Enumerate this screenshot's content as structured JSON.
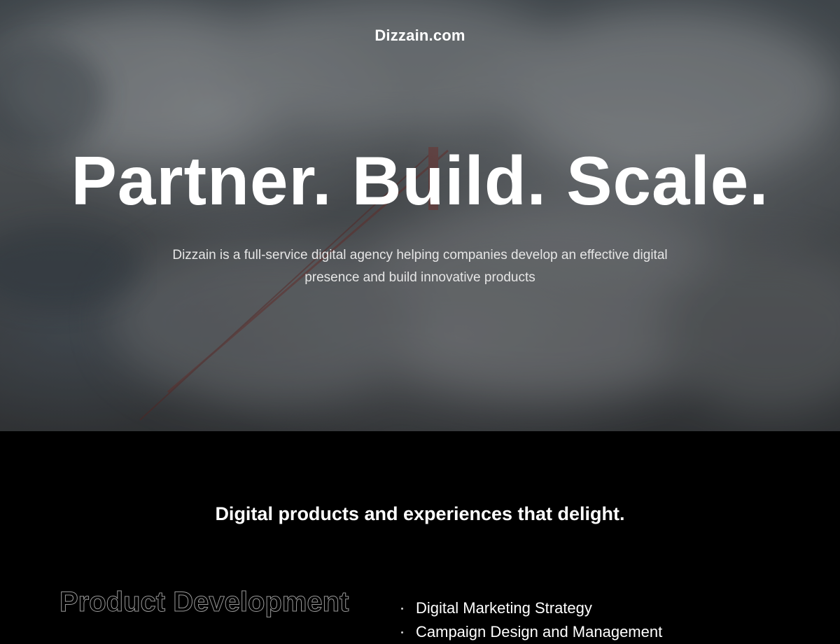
{
  "header": {
    "logo": "Dizzain.com"
  },
  "hero": {
    "headline": "Partner. Build. Scale.",
    "subhead": "Dizzain is a full-service digital agency helping companies develop an effective digital presence and build innovative products"
  },
  "intro": {
    "tagline": "Digital products and experiences that delight."
  },
  "services": {
    "category": "Product Development",
    "items": [
      {
        "label": "Digital Marketing Strategy"
      },
      {
        "label": "Campaign Design and Management"
      }
    ]
  },
  "colors": {
    "background_dark": "#000000",
    "text": "#ffffff",
    "outline_text": "#9a9a9a"
  }
}
